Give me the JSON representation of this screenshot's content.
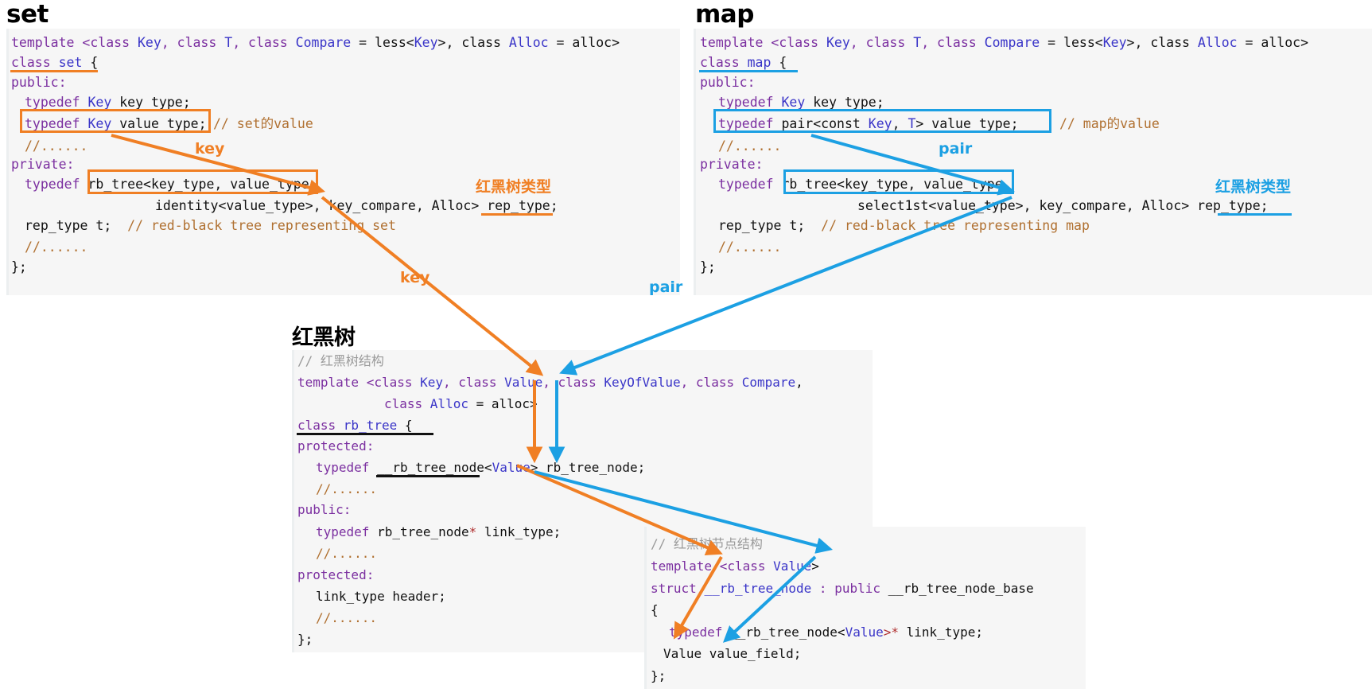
{
  "colors": {
    "orange": "#F07F24",
    "blue": "#1CA0E3",
    "panel_bg": "#f6f6f6",
    "keyword": "#7b2fa0",
    "type_param": "#3a35c8",
    "comment": "#b07030",
    "comment_cn": "#9a9a9a",
    "bracket": "#b03030"
  },
  "panels": {
    "set": {
      "title": "set",
      "lines": {
        "l1_template": "template <class ",
        "l1_key": "Key",
        "l1_mid1": ", class ",
        "l1_t": "T",
        "l1_mid2": ", class ",
        "l1_compare": "Compare",
        "l1_eq1": " = less<",
        "l1_key2": "Key",
        "l1_gt1": ">, class ",
        "l1_alloc": "Alloc",
        "l1_eq2": " = alloc>",
        "l2_kw": "class ",
        "l2_name": "set",
        "l2_brace": " {",
        "l3": "public:",
        "l4_kw": "typedef ",
        "l4_type": "Key",
        "l4_name": " key_type;",
        "l5_kw": "typedef ",
        "l5_type": "Key",
        "l5_name": " value_type;",
        "l5_comment": "// set的value",
        "l6": "//......",
        "l7": "private:",
        "l8_kw": "typedef ",
        "l8_code": "rb_tree<key_type, value_type,",
        "l9_code": "identity<value_type>, key_compare, Alloc> ",
        "l9_rep": "rep_type;",
        "l10_code": "rep_type t;  ",
        "l10_comment": "// red-black tree representing set",
        "l11": "//......",
        "l12": "};"
      },
      "annotations": {
        "rb_tree_type_label": "红黑树类型",
        "arrow_label_key_upper": "key",
        "arrow_label_key_lower": "key"
      }
    },
    "map": {
      "title": "map",
      "lines": {
        "l1_template": "template <class ",
        "l1_key": "Key",
        "l1_mid1": ", class ",
        "l1_t": "T",
        "l1_mid2": ", class ",
        "l1_compare": "Compare",
        "l1_eq1": " = less<",
        "l1_key2": "Key",
        "l1_gt1": ">, class ",
        "l1_alloc": "Alloc",
        "l1_eq2": " = alloc>",
        "l2_kw": "class ",
        "l2_name": "map",
        "l2_brace": " {",
        "l3": "public:",
        "l4_kw": "typedef ",
        "l4_type": "Key",
        "l4_name": " key_type;",
        "l5_kw": "typedef ",
        "l5_pair": "pair<const ",
        "l5_key": "Key",
        "l5_comma": ", ",
        "l5_t": "T",
        "l5_gt": "> value_type;",
        "l5_comment": "// map的value",
        "l6": "//......",
        "l7": "private:",
        "l8_kw": "typedef ",
        "l8_code": "rb_tree<key_type, value_type,",
        "l9_code": "select1st<value_type>, key_compare, Alloc> ",
        "l9_rep": "rep_type;",
        "l10_code": "rep_type t;  ",
        "l10_comment": "// red-black tree representing map",
        "l11": "//......",
        "l12": "};"
      },
      "annotations": {
        "rb_tree_type_label": "红黑树类型",
        "arrow_label_pair_upper": "pair",
        "arrow_label_pair_lower": "pair"
      }
    },
    "rb_tree": {
      "title": "红黑树",
      "lines": {
        "l1_comment": "// 红黑树结构",
        "l2_template": "template <class ",
        "l2_key": "Key",
        "l2_c1": ", class ",
        "l2_value": "Value",
        "l2_c2": ", class ",
        "l2_keyofvalue": "KeyOfValue",
        "l2_c3": ", class ",
        "l2_compare": "Compare",
        "l2_end": ",",
        "l3_kw": "class ",
        "l3_alloc": "Alloc",
        "l3_eq": " = alloc>",
        "l4_kw": "class ",
        "l4_name": "rb_tree",
        "l4_brace": " {",
        "l5": "protected:",
        "l6_kw": "typedef ",
        "l6_node": "__rb_tree_node<",
        "l6_value": "Value",
        "l6_end": "> rb_tree_node;",
        "l7": "//......",
        "l8": "public:",
        "l9_kw": "typedef ",
        "l9_code": "rb_tree_node",
        "l9_star": "*",
        "l9_end": " link_type;",
        "l10": "//......",
        "l11": "protected:",
        "l12": "link_type header;",
        "l13": "//......",
        "l14": "};"
      }
    },
    "rb_tree_node": {
      "lines": {
        "l1_comment": "// 红黑树节点结构",
        "l2_template": "template <class ",
        "l2_value": "Value",
        "l2_gt": ">",
        "l3_kw": "struct ",
        "l3_name": "__rb_tree_node",
        "l3_colon": " : public ",
        "l3_base": "__rb_tree_node_base",
        "l4": "{",
        "l5_kw": "typedef ",
        "l5_node": "__rb_tree_node<",
        "l5_value": "Value",
        "l5_gt": ">",
        "l5_star": "*",
        "l5_end": " link_type;",
        "l6": "Value value_field;",
        "l7": "};"
      }
    }
  }
}
